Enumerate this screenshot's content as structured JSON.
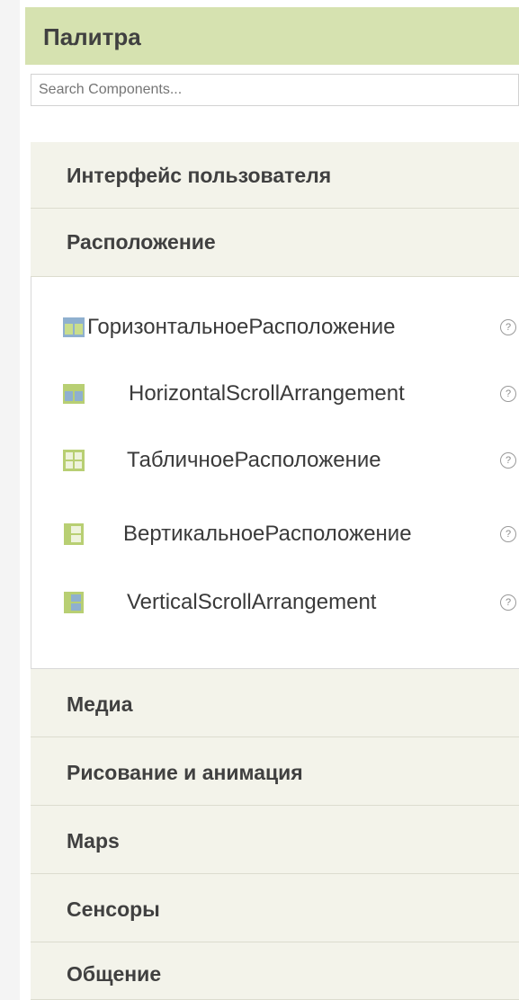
{
  "palette": {
    "title": "Палитра",
    "search_placeholder": "Search Components..."
  },
  "categories": {
    "ui": "Интерфейс пользователя",
    "layout": "Расположение",
    "media": "Медиа",
    "drawing": "Рисование и анимация",
    "maps": "Maps",
    "sensors": "Сенсоры",
    "social": "Общение"
  },
  "layout_components": [
    {
      "label": "ГоризонтальноеРасположение",
      "icon": "horizontal-arrangement-icon",
      "help": "?"
    },
    {
      "label": "HorizontalScrollArrangement",
      "icon": "horizontal-scroll-arrangement-icon",
      "help": "?"
    },
    {
      "label": "ТабличноеРасположение",
      "icon": "table-arrangement-icon",
      "help": "?"
    },
    {
      "label": "ВертикальноеРасположение",
      "icon": "vertical-arrangement-icon",
      "help": "?"
    },
    {
      "label": "VerticalScrollArrangement",
      "icon": "vertical-scroll-arrangement-icon",
      "help": "?"
    }
  ],
  "colors": {
    "header_bg": "#d6e2b0",
    "category_bg": "#f3f3ea",
    "icon_green": "#b8cf73",
    "icon_blue": "#8fb0cf"
  }
}
